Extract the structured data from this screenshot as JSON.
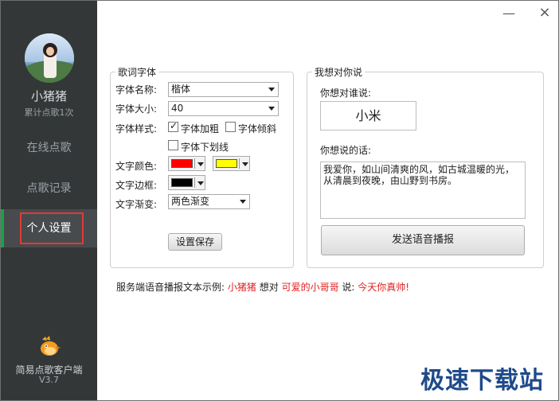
{
  "window": {
    "minimize_glyph": "—",
    "close_glyph": "×"
  },
  "sidebar": {
    "username": "小猪猪",
    "song_count": "累计点歌1次",
    "nav": {
      "online": "在线点歌",
      "history": "点歌记录",
      "settings": "个人设置"
    },
    "app_name": "简易点歌客户端",
    "app_version": "V3.7",
    "colors": {
      "background": "#333738",
      "active": "#474b4d",
      "accent": "#17a34a",
      "highlight_border": "#e53935"
    }
  },
  "lyrics_font": {
    "legend": "歌词字体",
    "font_name_label": "字体名称:",
    "font_name_value": "楷体",
    "font_size_label": "字体大小:",
    "font_size_value": "40",
    "font_style_label": "字体样式:",
    "bold_label": "字体加粗",
    "bold_checked": true,
    "italic_label": "字体倾斜",
    "italic_checked": false,
    "underline_label": "字体下划线",
    "underline_checked": false,
    "text_color_label": "文字颜色:",
    "text_color_1": "#ff0000",
    "text_color_2": "#ffff00",
    "border_label": "文字边框:",
    "border_color": "#000000",
    "gradient_label": "文字渐变:",
    "gradient_value": "两色渐变",
    "save_button": "设置保存"
  },
  "message": {
    "legend": "我想对你说",
    "to_label": "你想对谁说:",
    "to_value": "小米",
    "words_label": "你想说的话:",
    "words_value": "我爱你，如山间清爽的风，如古城温暖的光，从清晨到夜晚，由山野到书房。",
    "send_button": "发送语音播报"
  },
  "footer": {
    "prefix": "服务端语音播报文本示例:",
    "sender": "小猪猪",
    "to_word": "想对",
    "receiver": "可爱的小哥哥",
    "say_word": "说:",
    "content": "今天你真帅!"
  },
  "watermark": "极速下载站"
}
